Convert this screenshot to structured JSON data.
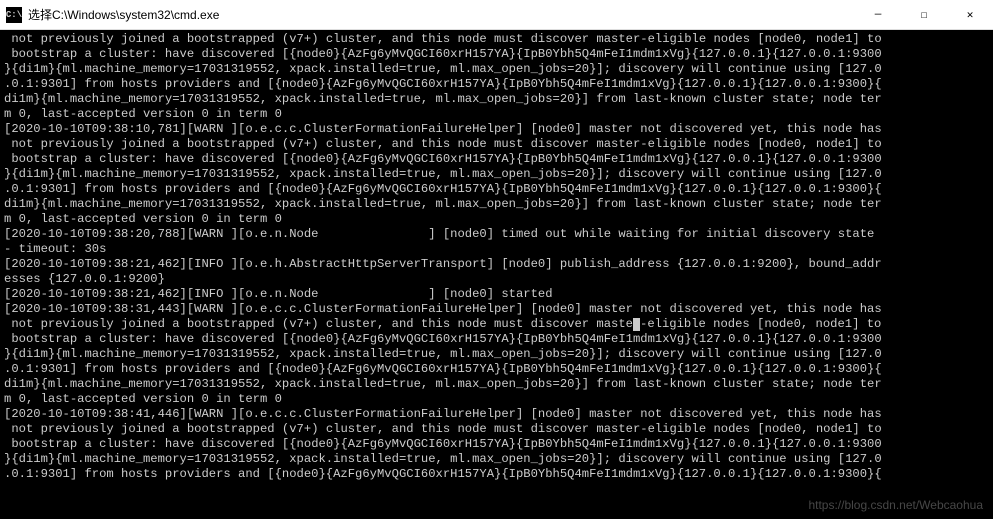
{
  "titlebar": {
    "icon_label": "C:\\",
    "title": "选择C:\\Windows\\system32\\cmd.exe"
  },
  "window_controls": {
    "minimize": "—",
    "maximize": "☐",
    "close": "✕"
  },
  "console": {
    "lines": [
      " not previously joined a bootstrapped (v7+) cluster, and this node must discover master-eligible nodes [node0, node1] to",
      " bootstrap a cluster: have discovered [{node0}{AzFg6yMvQGCI60xrH157YA}{IpB0Ybh5Q4mFeI1mdm1xVg}{127.0.0.1}{127.0.0.1:9300",
      "}{di1m}{ml.machine_memory=17031319552, xpack.installed=true, ml.max_open_jobs=20}]; discovery will continue using [127.0",
      ".0.1:9301] from hosts providers and [{node0}{AzFg6yMvQGCI60xrH157YA}{IpB0Ybh5Q4mFeI1mdm1xVg}{127.0.0.1}{127.0.0.1:9300}{",
      "di1m}{ml.machine_memory=17031319552, xpack.installed=true, ml.max_open_jobs=20}] from last-known cluster state; node ter",
      "m 0, last-accepted version 0 in term 0",
      "[2020-10-10T09:38:10,781][WARN ][o.e.c.c.ClusterFormationFailureHelper] [node0] master not discovered yet, this node has",
      " not previously joined a bootstrapped (v7+) cluster, and this node must discover master-eligible nodes [node0, node1] to",
      " bootstrap a cluster: have discovered [{node0}{AzFg6yMvQGCI60xrH157YA}{IpB0Ybh5Q4mFeI1mdm1xVg}{127.0.0.1}{127.0.0.1:9300",
      "}{di1m}{ml.machine_memory=17031319552, xpack.installed=true, ml.max_open_jobs=20}]; discovery will continue using [127.0",
      ".0.1:9301] from hosts providers and [{node0}{AzFg6yMvQGCI60xrH157YA}{IpB0Ybh5Q4mFeI1mdm1xVg}{127.0.0.1}{127.0.0.1:9300}{",
      "di1m}{ml.machine_memory=17031319552, xpack.installed=true, ml.max_open_jobs=20}] from last-known cluster state; node ter",
      "m 0, last-accepted version 0 in term 0",
      "[2020-10-10T09:38:20,788][WARN ][o.e.n.Node               ] [node0] timed out while waiting for initial discovery state ",
      "- timeout: 30s",
      "[2020-10-10T09:38:21,462][INFO ][o.e.h.AbstractHttpServerTransport] [node0] publish_address {127.0.0.1:9200}, bound_addr",
      "esses {127.0.0.1:9200}",
      "[2020-10-10T09:38:21,462][INFO ][o.e.n.Node               ] [node0] started",
      "[2020-10-10T09:38:31,443][WARN ][o.e.c.c.ClusterFormationFailureHelper] [node0] master not discovered yet, this node has",
      " not previously joined a bootstrapped (v7+) cluster, and this node must discover maste",
      "-eligible nodes [node0, node1] to",
      " bootstrap a cluster: have discovered [{node0}{AzFg6yMvQGCI60xrH157YA}{IpB0Ybh5Q4mFeI1mdm1xVg}{127.0.0.1}{127.0.0.1:9300",
      "}{di1m}{ml.machine_memory=17031319552, xpack.installed=true, ml.max_open_jobs=20}]; discovery will continue using [127.0",
      ".0.1:9301] from hosts providers and [{node0}{AzFg6yMvQGCI60xrH157YA}{IpB0Ybh5Q4mFeI1mdm1xVg}{127.0.0.1}{127.0.0.1:9300}{",
      "di1m}{ml.machine_memory=17031319552, xpack.installed=true, ml.max_open_jobs=20}] from last-known cluster state; node ter",
      "m 0, last-accepted version 0 in term 0",
      "[2020-10-10T09:38:41,446][WARN ][o.e.c.c.ClusterFormationFailureHelper] [node0] master not discovered yet, this node has",
      " not previously joined a bootstrapped (v7+) cluster, and this node must discover master-eligible nodes [node0, node1] to",
      " bootstrap a cluster: have discovered [{node0}{AzFg6yMvQGCI60xrH157YA}{IpB0Ybh5Q4mFeI1mdm1xVg}{127.0.0.1}{127.0.0.1:9300",
      "}{di1m}{ml.machine_memory=17031319552, xpack.installed=true, ml.max_open_jobs=20}]; discovery will continue using [127.0",
      ".0.1:9301] from hosts providers and [{node0}{AzFg6yMvQGCI60xrH157YA}{IpB0Ybh5Q4mFeI1mdm1xVg}{127.0.0.1}{127.0.0.1:9300}{"
    ],
    "cursor_line_index": 19
  },
  "watermark": "https://blog.csdn.net/Webcaohua"
}
